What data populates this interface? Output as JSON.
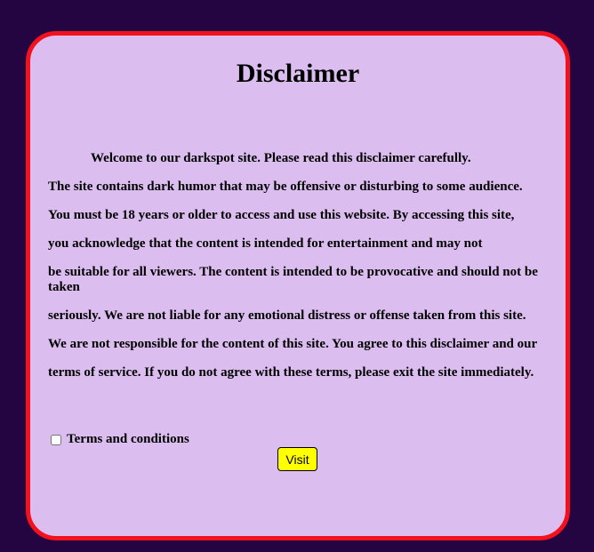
{
  "disclaimer": {
    "title": "Disclaimer",
    "paragraphs": [
      "Welcome to our darkspot site. Please read this disclaimer carefully.",
      "The site contains dark humor that may be offensive or disturbing to some audience.",
      "You must be 18 years or older to access and use this website. By accessing this site,",
      "you acknowledge that the content is intended for entertainment and may not",
      "be suitable for all viewers. The content is intended to be provocative and should not be taken",
      "seriously. We are not liable for any emotional distress or offense taken from this site.",
      "We are not responsible for the content of this site. You agree to this disclaimer and our",
      "terms of service. If you do not agree with these terms, please exit the site immediately."
    ],
    "terms_label": "Terms and conditions",
    "terms_checked": false,
    "visit_label": "Visit"
  },
  "colors": {
    "background": "#240441",
    "card": "#dbbdef",
    "border": "#f2111c",
    "button": "#ffff00"
  }
}
